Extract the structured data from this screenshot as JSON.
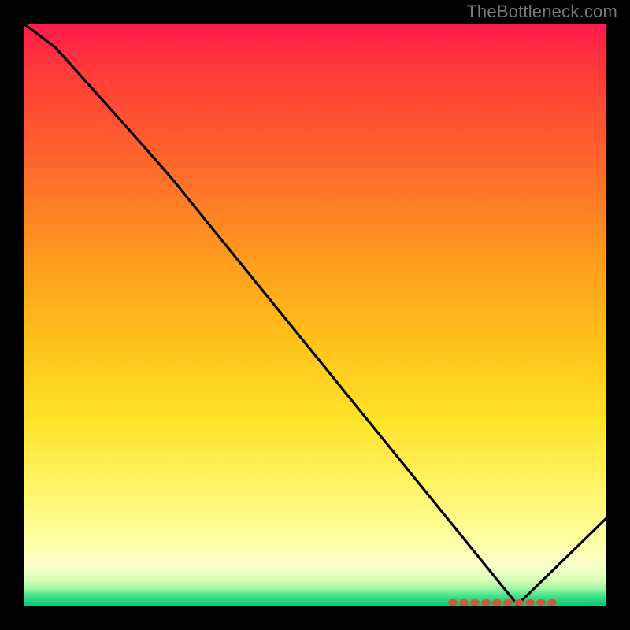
{
  "watermark": "TheBottleneck.com",
  "colors": {
    "line": "#000000",
    "dot_fill": "#cc5a3a",
    "dot_label": "#a04028"
  },
  "chart_data": {
    "type": "line",
    "title": "",
    "xlabel": "",
    "ylabel": "",
    "xlim": [
      0,
      100
    ],
    "ylim": [
      0,
      100
    ],
    "series": [
      {
        "name": "curve",
        "x": [
          0,
          5,
          25,
          85,
          100
        ],
        "y": [
          100,
          96,
          75,
          0,
          15
        ]
      }
    ],
    "marker_region": {
      "x_start": 73,
      "x_end": 91,
      "y": 0,
      "label": ""
    },
    "gradient_stops": [
      {
        "t": 0.0,
        "c": "#ff1a4b"
      },
      {
        "t": 0.4,
        "c": "#ff9a1e"
      },
      {
        "t": 0.8,
        "c": "#fff56a"
      },
      {
        "t": 0.97,
        "c": "#9cf5a2"
      },
      {
        "t": 1.0,
        "c": "#12c46f"
      }
    ]
  }
}
